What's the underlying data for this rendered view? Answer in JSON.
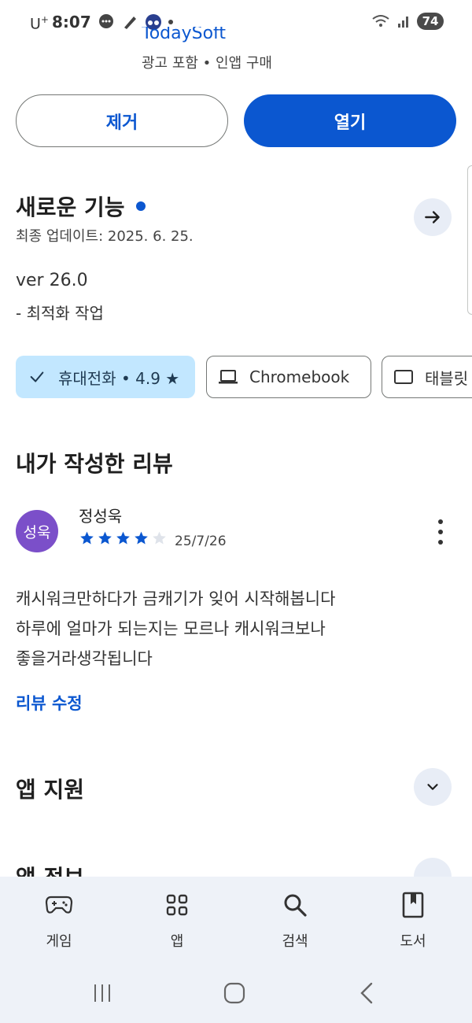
{
  "status_bar": {
    "carrier": "U",
    "carrier_sup": "+",
    "time": "8:07",
    "battery": "74"
  },
  "app_header": {
    "developer": "TodaySoft",
    "meta": "광고 포함 • 인앱 구매"
  },
  "actions": {
    "remove_label": "제거",
    "open_label": "열기"
  },
  "whats_new": {
    "title": "새로운 기능",
    "updated": "최종 업데이트: 2025. 6. 25.",
    "version": "ver 26.0",
    "note": "- 최적화 작업"
  },
  "devices": {
    "phone_label": "휴대전화 • 4.9 ★",
    "chromebook_label": "Chromebook",
    "tablet_label": "태블릿"
  },
  "my_review": {
    "section_title": "내가 작성한 리뷰",
    "avatar_text": "성욱",
    "avatar_color": "#7b4fc9",
    "reviewer": "정성욱",
    "rating": 4,
    "rating_max": 5,
    "date": "25/7/26",
    "text": "캐시워크만하다가 금캐기가 잊어 시작해봅니다\n하루에  얼마가 되는지는 모르나 캐시워크보나\n좋을거라생각됩니다",
    "edit_label": "리뷰 수정"
  },
  "app_support": {
    "title": "앱 지원"
  },
  "app_info": {
    "title": "앱 정보"
  },
  "bottom_nav": {
    "items": [
      {
        "label": "게임",
        "icon": "gamepad-icon"
      },
      {
        "label": "앱",
        "icon": "apps-grid-icon"
      },
      {
        "label": "검색",
        "icon": "search-icon"
      },
      {
        "label": "도서",
        "icon": "book-icon"
      }
    ]
  },
  "colors": {
    "accent": "#0b57d0",
    "chip_selected": "#c2e7ff",
    "nav_background": "#eef2f8"
  }
}
